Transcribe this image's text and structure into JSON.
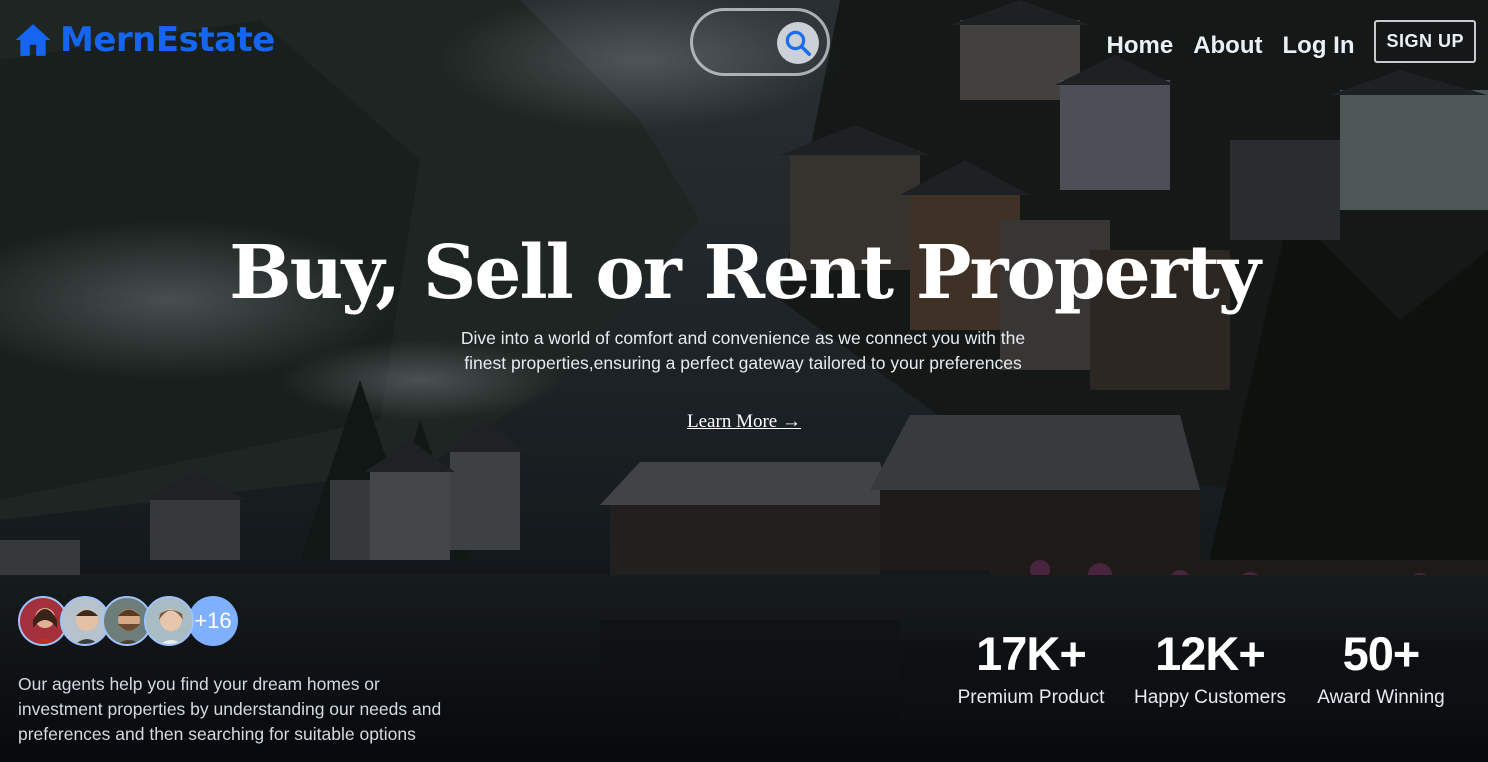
{
  "brand": {
    "name": "MernEstate",
    "icon": "house-icon",
    "color": "#1565f2"
  },
  "search": {
    "placeholder": "",
    "icon": "search-icon"
  },
  "nav": {
    "home": "Home",
    "about": "About",
    "login": "Log In",
    "signup": "SIGN UP"
  },
  "hero": {
    "headline": "Buy, Sell or Rent Property",
    "subtitle": "Dive into a world of comfort and convenience as we connect you with the finest properties,ensuring a perfect gateway tailored to your preferences",
    "cta": "Learn More →"
  },
  "agents": {
    "extra_count": "+16",
    "description": "Our agents help you find your dream homes or investment properties by understanding our needs and preferences and then searching for suitable options"
  },
  "stats": [
    {
      "value": "17K+",
      "label": "Premium Product"
    },
    {
      "value": "12K+",
      "label": "Happy Customers"
    },
    {
      "value": "50+",
      "label": "Award Winning"
    }
  ]
}
